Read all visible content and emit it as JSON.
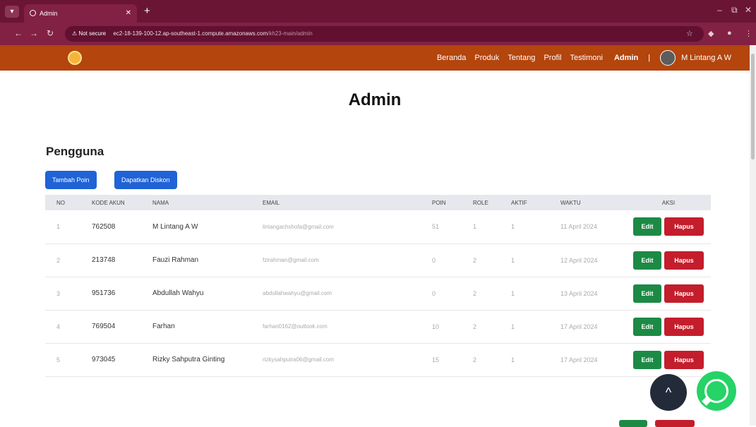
{
  "browser": {
    "tab_title": "Admin",
    "url_warning": "⚠ Not secure",
    "url_host": "ec2-18-139-100-12.ap-southeast-1.compute.amazonaws.com",
    "url_path": "/kh23-main/admin",
    "new_tab": "+",
    "minimize": "–",
    "maximize": "⧉",
    "close": "✕"
  },
  "navbar": {
    "links": [
      "Beranda",
      "Produk",
      "Tentang",
      "Profil",
      "Testimoni"
    ],
    "active": "Admin",
    "separator": "|",
    "user_name": "M Lintang A W"
  },
  "page": {
    "title": "Admin",
    "section": "Pengguna",
    "btn_add_points": "Tambah Poin",
    "btn_get_discount": "Dapatkan Diskon"
  },
  "table": {
    "headers": [
      "NO",
      "KODE AKUN",
      "NAMA",
      "EMAIL",
      "POIN",
      "ROLE",
      "AKTIF",
      "WAKTU",
      "AKSI"
    ],
    "rows": [
      {
        "no": "1",
        "code": "762508",
        "name": "M Lintang A W",
        "email": "lintangachshofa@gmail.com",
        "points": "51",
        "role": "1",
        "active": "1",
        "time": "11 April 2024"
      },
      {
        "no": "2",
        "code": "213748",
        "name": "Fauzi Rahman",
        "email": "fzirahman@gmail.com",
        "points": "0",
        "role": "2",
        "active": "1",
        "time": "12 April 2024"
      },
      {
        "no": "3",
        "code": "951736",
        "name": "Abdullah Wahyu",
        "email": "abdullahwahyu@gmail.com",
        "points": "0",
        "role": "2",
        "active": "1",
        "time": "13 April 2024"
      },
      {
        "no": "4",
        "code": "769504",
        "name": "Farhan",
        "email": "farhan0162@outlook.com",
        "points": "10",
        "role": "2",
        "active": "1",
        "time": "17 April 2024"
      },
      {
        "no": "5",
        "code": "973045",
        "name": "Rizky Sahputra Ginting",
        "email": "rizkysahputra06@gmail.com",
        "points": "15",
        "role": "2",
        "active": "1",
        "time": "17 April 2024"
      }
    ],
    "edit_label": "Edit",
    "delete_label": "Hapus"
  },
  "fab": {
    "scroll_up": "^"
  },
  "colors": {
    "navbar": "#b3450d",
    "primary_button": "#1f63d6",
    "edit_button": "#1c8a45",
    "delete_button": "#c41d2c",
    "whatsapp": "#25d366"
  },
  "icons": [
    "chrome-menu-icon",
    "tab-favicon-icon",
    "tab-close-icon",
    "back-icon",
    "forward-icon",
    "reload-icon",
    "star-icon",
    "extension-icon",
    "profile-icon",
    "kebab-icon",
    "logo-icon",
    "avatar",
    "chevron-up-icon",
    "whatsapp-icon"
  ]
}
